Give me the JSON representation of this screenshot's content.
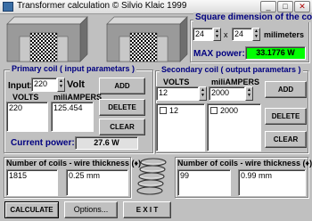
{
  "window": {
    "title": "Transformer calculation © Silvio Klaic 1999",
    "minimize_icon": "minimize-icon",
    "maximize_icon": "maximize-icon",
    "close_icon": "close-icon",
    "minimize_glyph": "_",
    "maximize_glyph": "□",
    "close_glyph": "✕"
  },
  "core": {
    "section_title": "Square dimension of the core",
    "dim_a": "24",
    "dim_x": "x",
    "dim_b": "24",
    "unit": "milimeters",
    "max_power_label": "MAX power:",
    "max_power_value": "33.1776 W",
    "max_power_color": "#00ff00"
  },
  "primary": {
    "section_title": "Primary coil ( input parametars )",
    "input_label": "Input:",
    "input_value": "220",
    "input_unit": "Volt",
    "volts_header": "VOLTS",
    "amps_header": "miliAMPERS",
    "volts_value": "220",
    "amps_value": "125.454",
    "current_power_label": "Current power:",
    "current_power_value": "27.6 W",
    "add_label": "ADD",
    "delete_label": "DELETE",
    "clear_label": "CLEAR"
  },
  "secondary": {
    "section_title": "Secondary coil ( output parametars )",
    "volts_header": "VOLTS",
    "amps_header": "miliAMPERS",
    "volts_input": "12",
    "amps_input": "2000",
    "volts_list_item": "12",
    "amps_list_item": "2000",
    "add_label": "ADD",
    "delete_label": "DELETE",
    "clear_label": "CLEAR"
  },
  "coils": {
    "primary_header": "Number of coils - wire thickness (♦)",
    "primary_turns": "1815",
    "primary_wire": "0.25 mm",
    "secondary_header": "Number of coils - wire thickness (♦)",
    "secondary_turns": "99",
    "secondary_wire": "0.99 mm"
  },
  "bottom": {
    "calculate_label": "CALCULATE",
    "options_label": "Options...",
    "exit_label": "E X I T"
  },
  "colors": {
    "section_title": "#000080",
    "current_power": "#000080"
  }
}
